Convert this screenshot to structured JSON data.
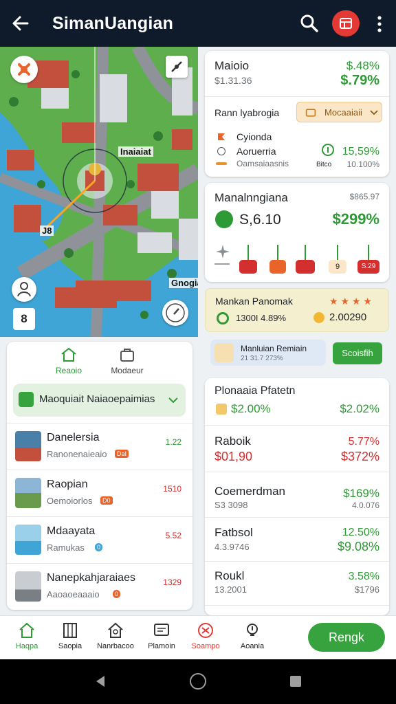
{
  "header": {
    "title": "SimanUangian",
    "colors": {
      "bg": "#0f1a2b",
      "accent": "#e53935"
    }
  },
  "map": {
    "label_top": "Inaiaiat",
    "label_bottom": "Gnogia",
    "label_small": "J8",
    "badge": "8"
  },
  "info_card": {
    "title": "Maioio",
    "title_pct": "$.48%",
    "sub": "$1.31.36",
    "sub_pct": "$.79%",
    "select_label": "Rann lyabrogia",
    "select_value": "Mocaaiaii",
    "opt1": "Cyionda",
    "opt2": "Aoruerria",
    "opt3": "Oamsaiaasnis",
    "pct_big": "15,59%",
    "pct_small_label": "Bitco",
    "pct_small": "10.100%"
  },
  "stat_card": {
    "title": "Manalnngiana",
    "code": "$865.97",
    "amount": "S,6.10",
    "amount_pct": "$299%",
    "bars": [
      "",
      "",
      "",
      "9",
      "S.29"
    ]
  },
  "promo": {
    "title": "Mankan Panomak",
    "left_val": "1300I 4.89%",
    "right_val": "2.00290"
  },
  "mini_banner": {
    "title": "Manluian Remiain",
    "sub": "21 31.7 273%",
    "button": "Scoisfih"
  },
  "price_card": {
    "title": "Plonaaia Pfatetn",
    "left": "$2.00%",
    "right": "$2.02%",
    "rows": [
      {
        "name": "Raboik",
        "value": "$01,90",
        "p1": "5.77%",
        "p2": "$372%",
        "up": false
      },
      {
        "name": "Coemerdman",
        "value": "S3 3098",
        "p1": "$169%",
        "p2": "4.0.076",
        "up": true
      },
      {
        "name": "Fatbsol",
        "value": "4.3.9746",
        "p1": "12.50%",
        "p2": "$9.08%",
        "up": true
      },
      {
        "name": "Roukl",
        "value": "13.2001",
        "p1": "3.58%",
        "p2": "$1796",
        "up": true
      }
    ]
  },
  "left_panel": {
    "tab1": "Reaoio",
    "tab2": "Modaeur",
    "dropdown": "Maoquiait Naiaoepaimias",
    "items": [
      {
        "title": "Danelersia",
        "sub": "Ranonenaieaio",
        "tag": "DaI",
        "value": "1.22"
      },
      {
        "title": "Raopian",
        "sub": "Oemoiorlos",
        "tag": "D0",
        "value": "1510"
      },
      {
        "title": "Mdaayata",
        "sub": "Ramukas",
        "tag": "0",
        "value": "5.52"
      },
      {
        "title": "Nanepkahjaraiaes",
        "sub": "Aaoaoeaaaio",
        "tag": "0",
        "value": "1329"
      }
    ]
  },
  "bottom_nav": {
    "items": [
      {
        "label": "Haqpa",
        "icon": "home-icon"
      },
      {
        "label": "Saopia",
        "icon": "building-icon"
      },
      {
        "label": "Nanrbacoo",
        "icon": "user-house-icon"
      },
      {
        "label": "Plamoin",
        "icon": "message-icon"
      },
      {
        "label": "Soampo",
        "icon": "ticket-icon"
      },
      {
        "label": "Aoania",
        "icon": "bulb-icon"
      }
    ],
    "cta": "Rengk"
  }
}
